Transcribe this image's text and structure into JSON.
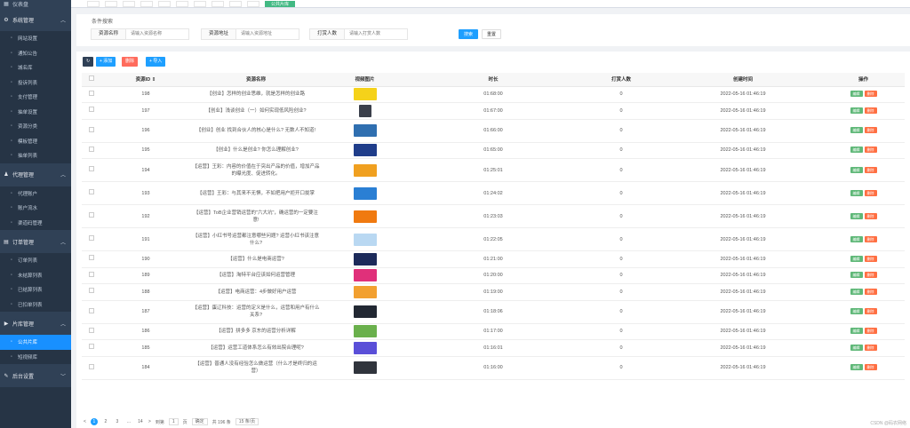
{
  "sidebar": {
    "top_label": "仪表盘",
    "groups": [
      {
        "label": "系统管理",
        "items": [
          "网站设置",
          "通知公告",
          "城名库",
          "投诉列表",
          "支付管理",
          "抽单设置",
          "资源分类",
          "模板管理",
          "抽单列表"
        ]
      },
      {
        "label": "代理管理",
        "items": [
          "代理账户",
          "账户流水",
          "渠道码管理"
        ]
      },
      {
        "label": "订单管理",
        "items": [
          "订单列表",
          "未结算列表",
          "已结算列表",
          "已扣单列表"
        ]
      },
      {
        "label": "片库管理",
        "items": [
          "公共片库",
          "短视频库"
        ]
      },
      {
        "label": "后台设置",
        "items": []
      }
    ],
    "active_item": "公共片库"
  },
  "tabs": [
    "",
    "",
    "",
    "",
    "",
    "",
    "",
    "",
    "",
    "",
    "公共片库"
  ],
  "search": {
    "title": "条件搜索",
    "fields": [
      {
        "label": "资源名称",
        "placeholder": "请输入资源名称"
      },
      {
        "label": "资源地址",
        "placeholder": "请输入资源地址"
      },
      {
        "label": "打赏人数",
        "placeholder": "请输入打赏人数"
      }
    ],
    "search_btn": "搜索",
    "reset_btn": "重置"
  },
  "toolbar": {
    "refresh_icon": "↻",
    "add": "+ 添加",
    "delete": "删除",
    "import": "+ 导入"
  },
  "table": {
    "headers": [
      "资源ID",
      "资源名称",
      "视频图片",
      "时长",
      "打赏人数",
      "创建时间",
      "操作"
    ],
    "edit_label": "编辑",
    "delete_label": "删除",
    "rows": [
      {
        "id": "198",
        "name": "【创业】怎样的创业思维，就是怎样的创业路",
        "duration": "01:68:00",
        "reward": "0",
        "created": "2022-05-16 01:46:19",
        "thumb": "#f5d21a",
        "tall": false
      },
      {
        "id": "197",
        "name": "【创业】浅谈创业（一）如何实现低风险创业?",
        "duration": "01:67:00",
        "reward": "0",
        "created": "2022-05-16 01:46:19",
        "thumb": "#3a3f4a",
        "tall": false,
        "small": true
      },
      {
        "id": "196",
        "name": "【创业】创业 找到合伙人的核心是什么? 无数人不知道!",
        "duration": "01:66:00",
        "reward": "0",
        "created": "2022-05-16 01:46:19",
        "thumb": "#2f6fb0",
        "tall": true
      },
      {
        "id": "195",
        "name": "【创业】什么是创业? 你怎么理解创业?",
        "duration": "01:65:00",
        "reward": "0",
        "created": "2022-05-16 01:46:19",
        "thumb": "#1f3d8a",
        "tall": false
      },
      {
        "id": "194",
        "name": "【运营】王彩：内容的价值在于突出产品的价值，增加产品的曝光度、促进转化。",
        "duration": "01:25:01",
        "reward": "0",
        "created": "2022-05-16 01:46:19",
        "thumb": "#f0a020",
        "tall": true
      },
      {
        "id": "193",
        "name": "【运营】王彩：与其来不无惧，不如把用户拒开口拢掌",
        "duration": "01:24:02",
        "reward": "0",
        "created": "2022-05-16 01:46:19",
        "thumb": "#2a7fd4",
        "tall": true
      },
      {
        "id": "192",
        "name": "【运营】ToB企业营销运营的\"六大坑\"，确运营的一定要注意!",
        "duration": "01:23:03",
        "reward": "0",
        "created": "2022-05-16 01:46:19",
        "thumb": "#f07a10",
        "tall": true
      },
      {
        "id": "191",
        "name": "【运营】小红书号运营都注意哪些问题? 运营小红书该注意什么?",
        "duration": "01:22:05",
        "reward": "0",
        "created": "2022-05-16 01:46:19",
        "thumb": "#b9d8f2",
        "tall": true
      },
      {
        "id": "190",
        "name": "【运营】什么是电商运营?",
        "duration": "01:21:00",
        "reward": "0",
        "created": "2022-05-16 01:46:19",
        "thumb": "#1c2a5a",
        "tall": false
      },
      {
        "id": "189",
        "name": "【运营】淘特平台应该如何运营管理",
        "duration": "01:20:00",
        "reward": "0",
        "created": "2022-05-16 01:46:19",
        "thumb": "#e0307a",
        "tall": false
      },
      {
        "id": "188",
        "name": "【运营】电商运营：4步做好用户运营",
        "duration": "01:19:00",
        "reward": "0",
        "created": "2022-05-16 01:46:19",
        "thumb": "#f2a030",
        "tall": false
      },
      {
        "id": "187",
        "name": "【运营】蛋辽科技：运营的定义是什么，运营和用户有什么关系?",
        "duration": "01:18:06",
        "reward": "0",
        "created": "2022-05-16 01:46:19",
        "thumb": "#222833",
        "tall": true
      },
      {
        "id": "186",
        "name": "【运营】拼多多 京东的运营分析详解",
        "duration": "01:17:00",
        "reward": "0",
        "created": "2022-05-16 01:46:19",
        "thumb": "#6ab04c",
        "tall": false
      },
      {
        "id": "185",
        "name": "【运营】运营工道体系怎么有效出院合理呢?",
        "duration": "01:16:01",
        "reward": "0",
        "created": "2022-05-16 01:46:19",
        "thumb": "#5a4fd8",
        "tall": false
      },
      {
        "id": "184",
        "name": "【运营】普通人没有经验怎么做运营（什么才是终归的运营）",
        "duration": "01:16:00",
        "reward": "0",
        "created": "2022-05-16 01:46:19",
        "thumb": "#30343c",
        "tall": true
      }
    ]
  },
  "pager": {
    "prev": "<",
    "pages": [
      "1",
      "2",
      "3",
      "...",
      "14"
    ],
    "next": ">",
    "goto": "到第",
    "goto_value": "1",
    "page_unit": "页",
    "confirm": "确定",
    "total": "共 196 条",
    "per_page": "15 条/页"
  },
  "watermark": "CSDN @码农网络"
}
